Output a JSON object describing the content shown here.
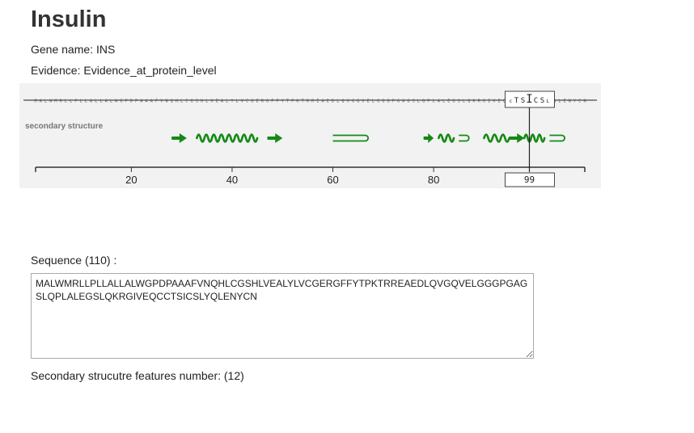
{
  "page": {
    "title": "Insulin",
    "gene_name": "Gene name: INS",
    "evidence": "Evidence: Evidence_at_protein_level"
  },
  "viewer": {
    "track_label": "secondary structure",
    "sequence": "MALWMRLLPLLALLALWGPDPAAAFVNQHLCGSHLVEALYLVCGERGFFYTPKTRREAEDLQVGQVELGGGPGAGSLQPLALEGSLQKRGIVEQCCTSICSLYQLENYCN",
    "highlight": {
      "position": 99,
      "label": "99",
      "zoom_text": [
        "c",
        "T",
        "S",
        "I",
        "C",
        "S",
        "L"
      ]
    },
    "axis": {
      "min": 1,
      "max": 110,
      "ticks": [
        20,
        40,
        60,
        80
      ]
    },
    "features": [
      {
        "type": "strand",
        "start": 28,
        "end": 31
      },
      {
        "type": "helix",
        "start": 33,
        "end": 45
      },
      {
        "type": "strand",
        "start": 47,
        "end": 50
      },
      {
        "type": "turn",
        "start": 60,
        "end": 67
      },
      {
        "type": "strand",
        "start": 78,
        "end": 80
      },
      {
        "type": "helix",
        "start": 81,
        "end": 84
      },
      {
        "type": "turn",
        "start": 85,
        "end": 87
      },
      {
        "type": "helix",
        "start": 90,
        "end": 95
      },
      {
        "type": "strand",
        "start": 95,
        "end": 98
      },
      {
        "type": "helix",
        "start": 98,
        "end": 102
      },
      {
        "type": "turn",
        "start": 103,
        "end": 106
      }
    ],
    "colors": {
      "feature": "#138a13",
      "axis": "#333333",
      "background": "#f2f2f2"
    }
  },
  "sequence_section": {
    "label": "Sequence (110) :",
    "value": "MALWMRLLPLLALLALWGPDPAAAFVNQHLCGSHLVEALYLVCGERGFFYTPKTRREAEDLQVGQVELGGGPGAGSLQPLALEGSLQKRGIVEQCCTSICSLYQLENYCN"
  },
  "secondary_section": {
    "label": "Secondary strucutre features number: (12)"
  }
}
